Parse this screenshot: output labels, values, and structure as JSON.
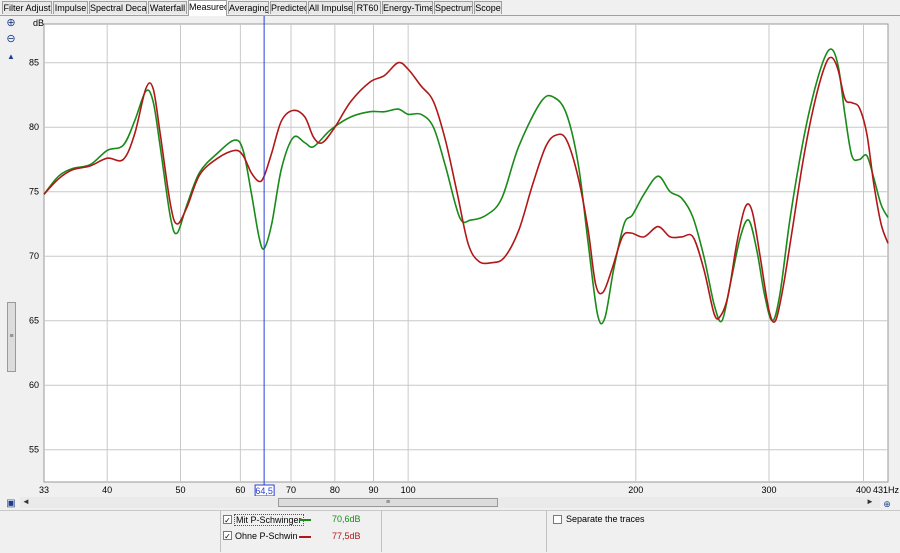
{
  "tabs": [
    "Filter Adjust",
    "Impulse",
    "Spectral Decay",
    "Waterfall",
    "Measured",
    "Averaging",
    "Predicted",
    "All Impulses",
    "RT60",
    "Energy-Time",
    "Spectrum",
    "Scope"
  ],
  "active_tab": "Measured",
  "cursor": {
    "frequency": 64.5,
    "label": "64,5"
  },
  "chart_data": {
    "type": "line",
    "title": "",
    "xlabel": "Hz",
    "ylabel": "dB",
    "x_scale": "log",
    "xlim": [
      33,
      431
    ],
    "ylim": [
      52.5,
      88
    ],
    "x_ticks": [
      33,
      40,
      50,
      60,
      70,
      80,
      90,
      100,
      200,
      300,
      400,
      431
    ],
    "x_tick_labels": [
      "33",
      "40",
      "50",
      "60",
      "",
      "70",
      "80",
      "90",
      "100",
      "200",
      "300",
      "400",
      "431Hz"
    ],
    "y_ticks": [
      55,
      60,
      65,
      70,
      75,
      80,
      85
    ],
    "y_tick_labels": [
      "55",
      "60",
      "65",
      "70",
      "75",
      "80",
      "85"
    ],
    "grid": true,
    "series": [
      {
        "name": "Mit P-Schwinger",
        "color": "#1a8a1a",
        "readout": "70,6dB",
        "points": [
          [
            33,
            74.8
          ],
          [
            34.5,
            76.2
          ],
          [
            36,
            76.8
          ],
          [
            38,
            77.1
          ],
          [
            40,
            78.2
          ],
          [
            42,
            78.6
          ],
          [
            43.5,
            80.5
          ],
          [
            45,
            82.8
          ],
          [
            46,
            82.0
          ],
          [
            47,
            78.5
          ],
          [
            48.5,
            73.0
          ],
          [
            49.5,
            71.8
          ],
          [
            51,
            74.0
          ],
          [
            53,
            76.5
          ],
          [
            56,
            78.0
          ],
          [
            59,
            79.0
          ],
          [
            60.5,
            78.2
          ],
          [
            62,
            75.0
          ],
          [
            63.5,
            71.5
          ],
          [
            64.5,
            70.6
          ],
          [
            66,
            72.5
          ],
          [
            68,
            76.8
          ],
          [
            70.5,
            79.2
          ],
          [
            73,
            78.8
          ],
          [
            75,
            78.5
          ],
          [
            79,
            79.8
          ],
          [
            84,
            80.8
          ],
          [
            89,
            81.2
          ],
          [
            93,
            81.2
          ],
          [
            97,
            81.4
          ],
          [
            100,
            81.0
          ],
          [
            104,
            81.0
          ],
          [
            108,
            80.0
          ],
          [
            112,
            77.0
          ],
          [
            117,
            73.0
          ],
          [
            121,
            72.8
          ],
          [
            127,
            73.2
          ],
          [
            133,
            74.5
          ],
          [
            140,
            78.5
          ],
          [
            150,
            82.0
          ],
          [
            156,
            82.3
          ],
          [
            162,
            81.0
          ],
          [
            168,
            77.0
          ],
          [
            173,
            71.0
          ],
          [
            178,
            65.5
          ],
          [
            182,
            65.2
          ],
          [
            187,
            69.0
          ],
          [
            193,
            72.5
          ],
          [
            198,
            73.2
          ],
          [
            205,
            74.8
          ],
          [
            214,
            76.2
          ],
          [
            222,
            75.0
          ],
          [
            230,
            74.5
          ],
          [
            238,
            73.0
          ],
          [
            246,
            70.0
          ],
          [
            254,
            66.2
          ],
          [
            260,
            65.0
          ],
          [
            267,
            68.0
          ],
          [
            275,
            71.5
          ],
          [
            282,
            72.8
          ],
          [
            289,
            70.5
          ],
          [
            296,
            67.0
          ],
          [
            303,
            65.0
          ],
          [
            310,
            67.0
          ],
          [
            320,
            73.0
          ],
          [
            333,
            79.0
          ],
          [
            345,
            83.0
          ],
          [
            356,
            85.5
          ],
          [
            364,
            86.0
          ],
          [
            371,
            84.5
          ],
          [
            378,
            81.0
          ],
          [
            386,
            77.8
          ],
          [
            395,
            77.5
          ],
          [
            404,
            77.8
          ],
          [
            413,
            76.0
          ],
          [
            422,
            74.0
          ],
          [
            431,
            73.0
          ]
        ]
      },
      {
        "name": "Ohne P-Schwin",
        "color": "#b01818",
        "readout": "77,5dB",
        "points": [
          [
            33,
            74.8
          ],
          [
            34.5,
            76.0
          ],
          [
            36,
            76.7
          ],
          [
            38,
            77.0
          ],
          [
            40,
            77.6
          ],
          [
            42,
            77.5
          ],
          [
            43.5,
            79.5
          ],
          [
            45,
            83.0
          ],
          [
            46,
            83.0
          ],
          [
            47,
            79.5
          ],
          [
            48.5,
            74.0
          ],
          [
            49.5,
            72.5
          ],
          [
            51,
            73.8
          ],
          [
            53,
            76.3
          ],
          [
            56,
            77.6
          ],
          [
            59,
            78.2
          ],
          [
            60.5,
            77.8
          ],
          [
            62,
            76.5
          ],
          [
            63.5,
            75.8
          ],
          [
            64.5,
            76.2
          ],
          [
            66,
            78.0
          ],
          [
            68,
            80.5
          ],
          [
            70.5,
            81.3
          ],
          [
            73,
            80.8
          ],
          [
            75,
            79.2
          ],
          [
            77,
            78.8
          ],
          [
            80,
            80.0
          ],
          [
            84,
            82.0
          ],
          [
            89,
            83.5
          ],
          [
            93,
            84.0
          ],
          [
            97,
            85.0
          ],
          [
            100,
            84.5
          ],
          [
            104,
            83.2
          ],
          [
            108,
            82.0
          ],
          [
            112,
            79.0
          ],
          [
            116,
            75.0
          ],
          [
            120,
            71.0
          ],
          [
            124,
            69.6
          ],
          [
            129,
            69.5
          ],
          [
            134,
            69.9
          ],
          [
            140,
            72.0
          ],
          [
            146,
            75.5
          ],
          [
            152,
            78.5
          ],
          [
            157,
            79.4
          ],
          [
            162,
            79.0
          ],
          [
            168,
            76.0
          ],
          [
            173,
            72.0
          ],
          [
            177,
            67.8
          ],
          [
            181,
            67.2
          ],
          [
            186,
            69.0
          ],
          [
            192,
            71.5
          ],
          [
            197,
            71.8
          ],
          [
            205,
            71.5
          ],
          [
            214,
            72.3
          ],
          [
            222,
            71.5
          ],
          [
            230,
            71.5
          ],
          [
            238,
            71.5
          ],
          [
            246,
            69.0
          ],
          [
            254,
            65.5
          ],
          [
            259,
            65.4
          ],
          [
            265,
            67.0
          ],
          [
            272,
            71.0
          ],
          [
            279,
            73.8
          ],
          [
            285,
            73.5
          ],
          [
            292,
            70.0
          ],
          [
            300,
            65.8
          ],
          [
            306,
            65.0
          ],
          [
            313,
            67.5
          ],
          [
            322,
            72.0
          ],
          [
            333,
            77.5
          ],
          [
            345,
            82.0
          ],
          [
            356,
            84.8
          ],
          [
            363,
            85.4
          ],
          [
            370,
            84.5
          ],
          [
            378,
            82.2
          ],
          [
            386,
            81.9
          ],
          [
            395,
            81.5
          ],
          [
            404,
            79.5
          ],
          [
            413,
            75.5
          ],
          [
            422,
            72.5
          ],
          [
            431,
            71.0
          ]
        ]
      }
    ]
  },
  "legend_panel": {
    "separate_label": "Separate the traces",
    "scroll_grip": "≡"
  }
}
